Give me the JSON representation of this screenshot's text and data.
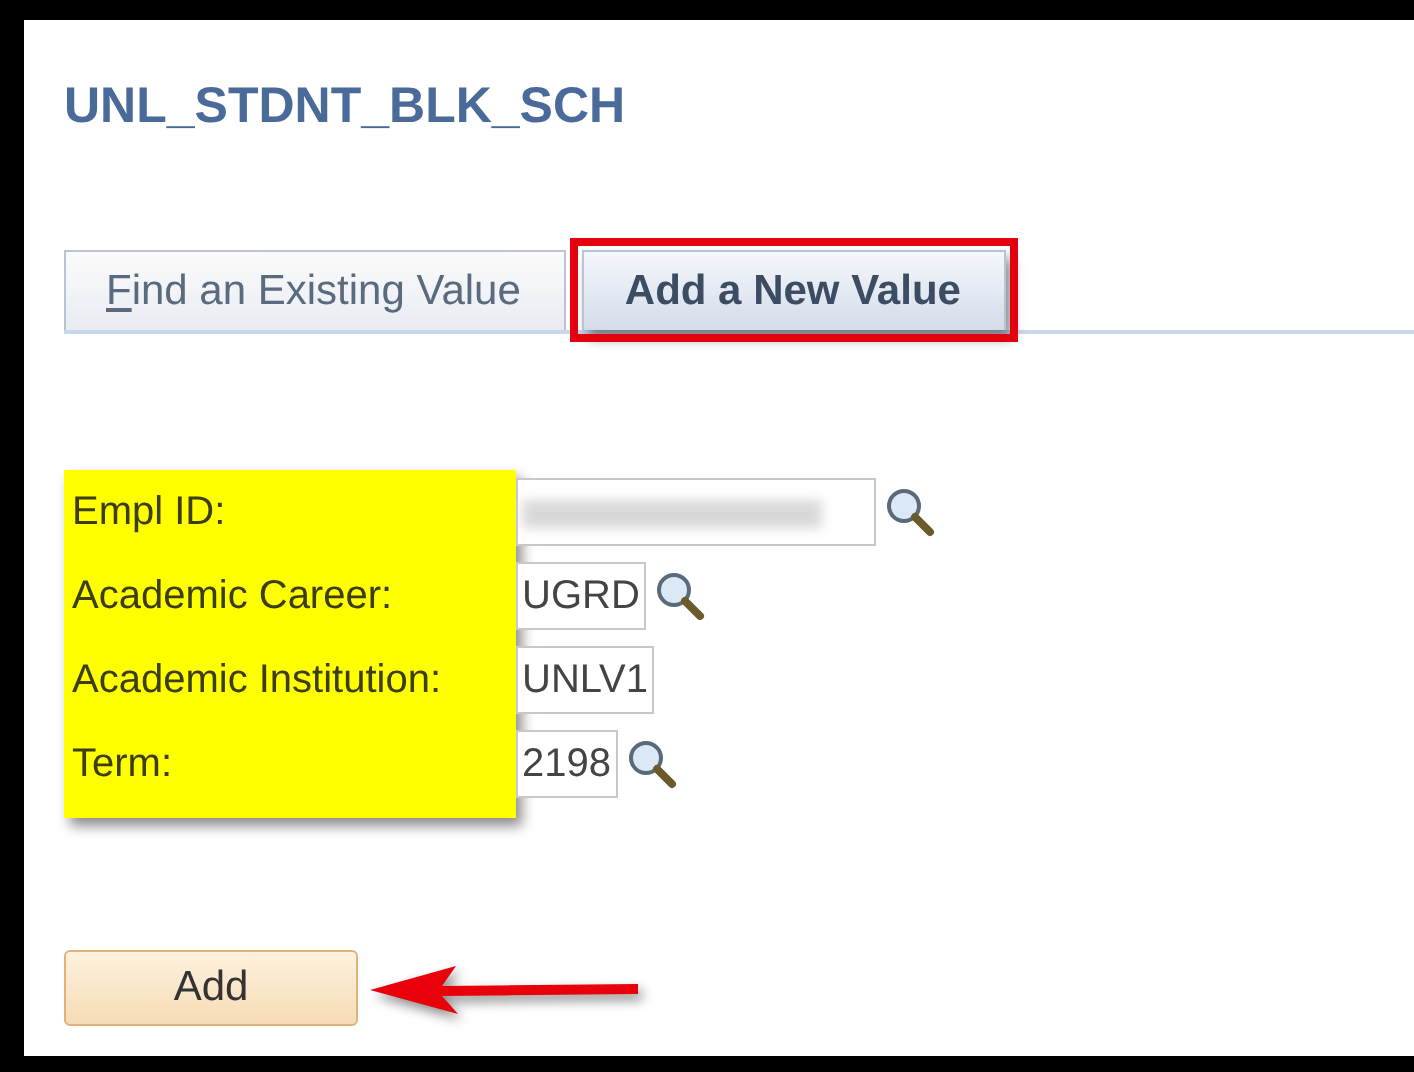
{
  "page_title": "UNL_STDNT_BLK_SCH",
  "tabs": [
    {
      "label": "Find an Existing Value",
      "selected": false
    },
    {
      "label": "Add a New Value",
      "selected": true
    }
  ],
  "annotations": {
    "selected_tab_outline": true,
    "labels_highlight": true,
    "arrow_to_add_button": true
  },
  "fields": [
    {
      "label": "Empl ID:",
      "kind": "lookup",
      "redacted": true
    },
    {
      "label": "Academic Career:",
      "kind": "lookup",
      "value": "UGRD"
    },
    {
      "label": "Academic Institution:",
      "kind": "text",
      "value": "UNLV1"
    },
    {
      "label": "Term:",
      "kind": "lookup",
      "value": "2198"
    }
  ],
  "buttons": [
    {
      "label": "Add"
    }
  ]
}
